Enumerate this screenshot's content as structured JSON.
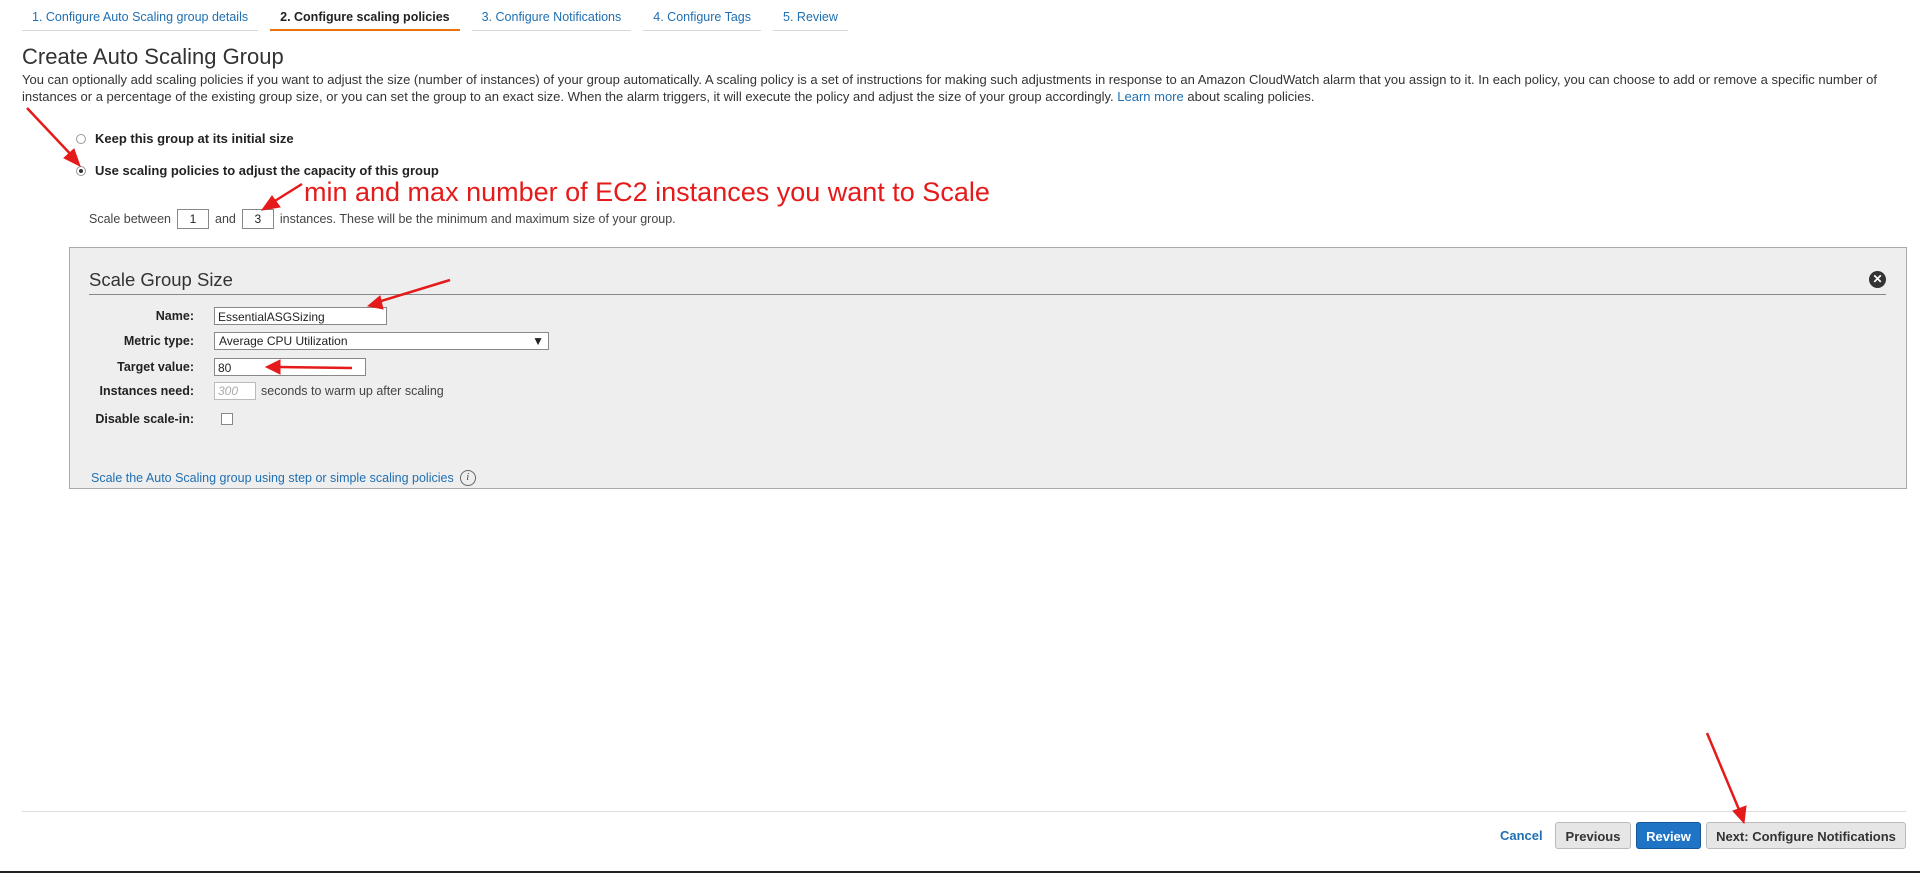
{
  "tabs": [
    {
      "label": "1. Configure Auto Scaling group details",
      "active": false
    },
    {
      "label": "2. Configure scaling policies",
      "active": true
    },
    {
      "label": "3. Configure Notifications",
      "active": false
    },
    {
      "label": "4. Configure Tags",
      "active": false
    },
    {
      "label": "5. Review",
      "active": false
    }
  ],
  "page": {
    "title": "Create Auto Scaling Group",
    "description_before_link": "You can optionally add scaling policies if you want to adjust the size (number of instances) of your group automatically. A scaling policy is a set of instructions for making such adjustments in response to an Amazon CloudWatch alarm that you assign to it. In each policy, you can choose to add or remove a specific number of instances or a percentage of the existing group size, or you can set the group to an exact size. When the alarm triggers, it will execute the policy and adjust the size of your group accordingly. ",
    "learn_more": "Learn more",
    "description_after_link": " about scaling policies."
  },
  "options": {
    "keep_initial": "Keep this group at its initial size",
    "use_policies": "Use scaling policies to adjust the capacity of this group",
    "selected": "use_policies"
  },
  "scale_range": {
    "prefix": "Scale between",
    "min": "1",
    "and": "and",
    "max": "3",
    "suffix": "instances. These will be the minimum and maximum size of your group."
  },
  "panel": {
    "title": "Scale Group Size",
    "name_label": "Name:",
    "name_value": "EssentialASGSizing",
    "metric_label": "Metric type:",
    "metric_value": "Average CPU Utilization",
    "target_label": "Target value:",
    "target_value": "80",
    "warmup_label": "Instances need:",
    "warmup_placeholder": "300",
    "warmup_suffix": "seconds to warm up after scaling",
    "disable_label": "Disable scale-in:",
    "step_link": "Scale the Auto Scaling group using step or simple scaling policies"
  },
  "footer": {
    "cancel": "Cancel",
    "previous": "Previous",
    "review": "Review",
    "next": "Next: Configure Notifications"
  },
  "annotation": {
    "text": "min and max number of EC2 instances you want to Scale",
    "color": "#e51a1a"
  },
  "icons": {
    "close": "close-icon",
    "info": "info-icon",
    "dropdown": "dropdown-arrow-icon"
  }
}
